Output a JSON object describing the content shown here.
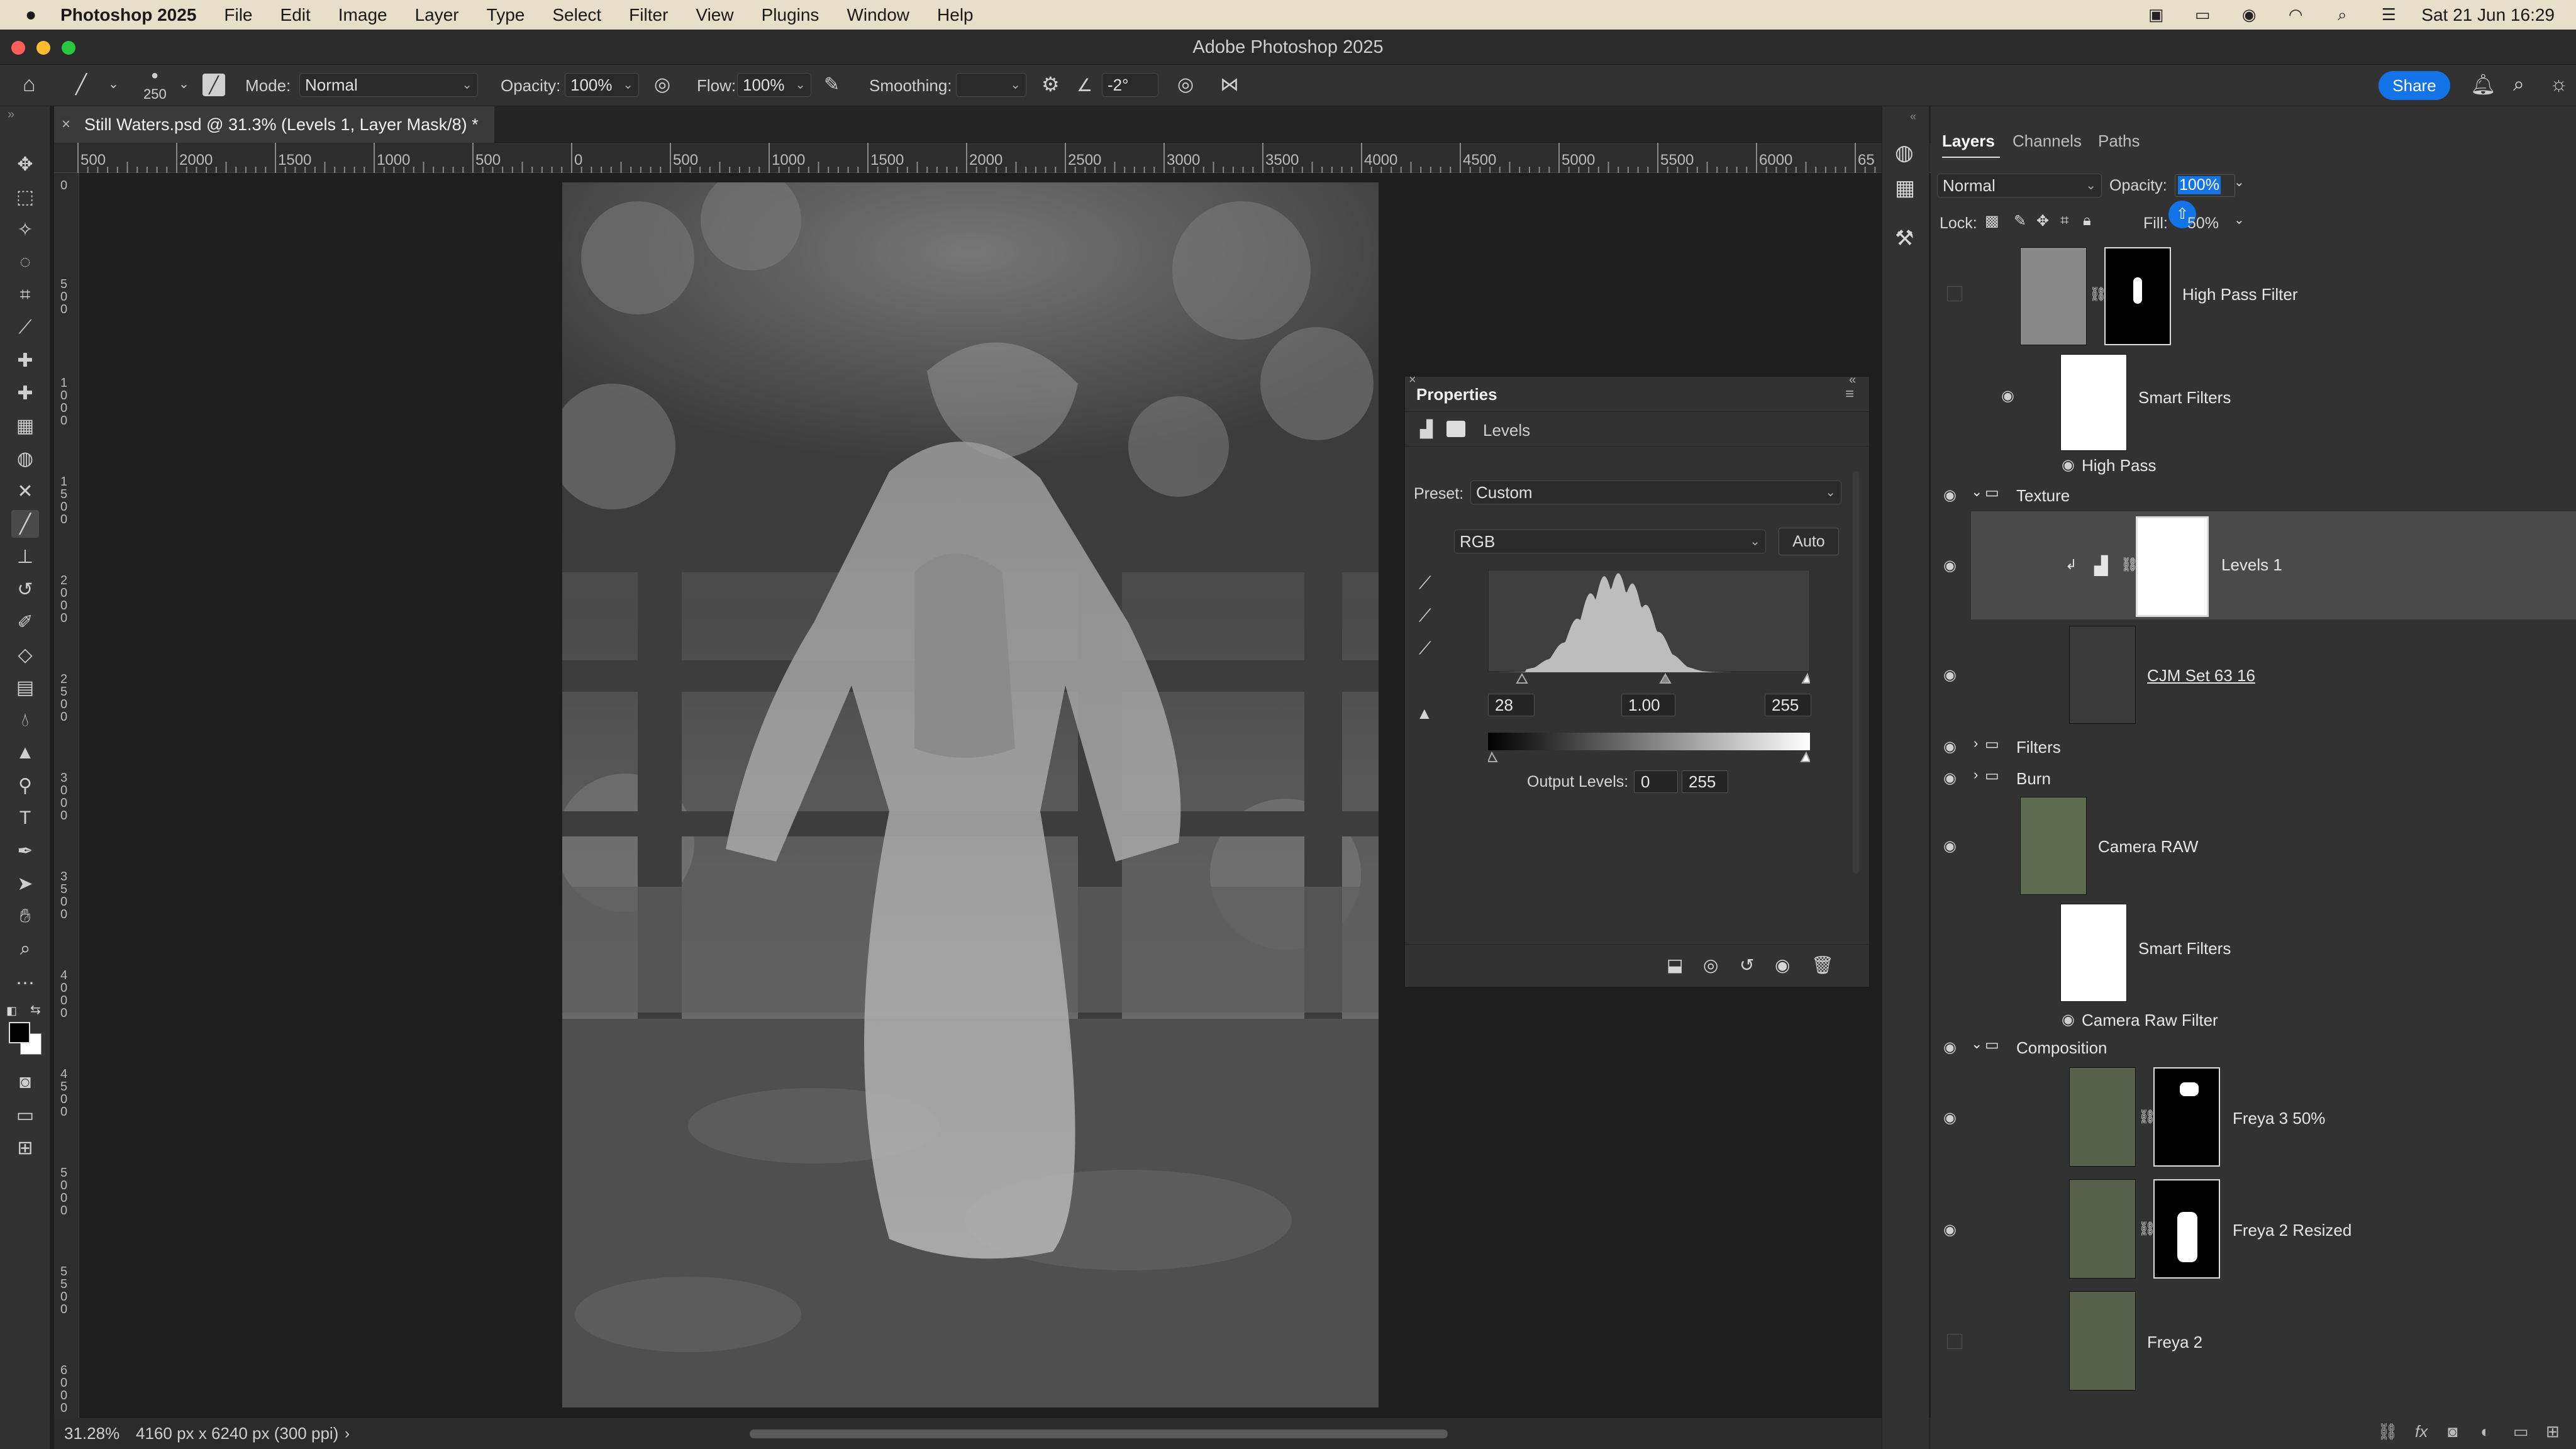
{
  "menubar": {
    "app_name": "Photoshop 2025",
    "items": [
      "File",
      "Edit",
      "Image",
      "Layer",
      "Type",
      "Select",
      "Filter",
      "View",
      "Plugins",
      "Window",
      "Help"
    ],
    "clock": "Sat 21 Jun  16:29"
  },
  "window": {
    "title": "Adobe Photoshop 2025"
  },
  "options": {
    "brush_size": "250",
    "mode_label": "Mode:",
    "mode_value": "Normal",
    "opacity_label": "Opacity:",
    "opacity_value": "100%",
    "flow_label": "Flow:",
    "flow_value": "100%",
    "smoothing_label": "Smoothing:",
    "smoothing_value": "",
    "angle_value": "-2°",
    "share_label": "Share"
  },
  "document": {
    "tab_title": "Still Waters.psd @ 31.3% (Levels 1, Layer Mask/8) *",
    "zoom": "31.28%",
    "doc_info": "4160 px x 6240 px (300 ppi)"
  },
  "ruler": {
    "h_labels": [
      "500",
      "2000",
      "1500",
      "1000",
      "500",
      "0",
      "500",
      "1000",
      "1500",
      "2000",
      "2500",
      "3000",
      "3500",
      "4000",
      "4500",
      "5000",
      "5500",
      "6000",
      "65"
    ],
    "v_labels": [
      "0",
      "500",
      "1000",
      "1500",
      "2000",
      "2500",
      "3000",
      "3500",
      "4000",
      "4500",
      "5000",
      "5500",
      "6000"
    ]
  },
  "properties": {
    "panel_title": "Properties",
    "adjustment_name": "Levels",
    "preset_label": "Preset:",
    "preset_value": "Custom",
    "channel_value": "RGB",
    "auto_label": "Auto",
    "input_black": "28",
    "input_gamma": "1.00",
    "input_white": "255",
    "output_label": "Output Levels:",
    "output_black": "0",
    "output_white": "255"
  },
  "layers_panel": {
    "tabs": [
      "Layers",
      "Channels",
      "Paths"
    ],
    "blend_mode": "Normal",
    "opacity_label": "Opacity:",
    "opacity_value": "100%",
    "lock_label": "Lock:",
    "fill_label": "Fill:",
    "fill_value": "50%",
    "layers": [
      {
        "name": "High Pass Filter",
        "visible": false
      },
      {
        "name": "Smart Filters",
        "visible": true
      },
      {
        "name": "High Pass",
        "visible": true
      },
      {
        "name": "Texture",
        "visible": true,
        "group": true,
        "expanded": true
      },
      {
        "name": "Levels 1",
        "visible": true,
        "selected": true
      },
      {
        "name": "CJM Set 63 16",
        "visible": true
      },
      {
        "name": "Filters",
        "visible": true,
        "group": true,
        "expanded": false
      },
      {
        "name": "Burn",
        "visible": true,
        "group": true,
        "expanded": false
      },
      {
        "name": "Camera RAW",
        "visible": true
      },
      {
        "name": "Smart Filters",
        "visible": true
      },
      {
        "name": "Camera Raw Filter",
        "visible": true
      },
      {
        "name": "Composition",
        "visible": true,
        "group": true,
        "expanded": true
      },
      {
        "name": "Freya 3 50%",
        "visible": true
      },
      {
        "name": "Freya 2 Resized",
        "visible": true
      },
      {
        "name": "Freya 2",
        "visible": false
      }
    ]
  },
  "colors": {
    "accent": "#1473e6",
    "selected_row": "#4a4a4a"
  }
}
